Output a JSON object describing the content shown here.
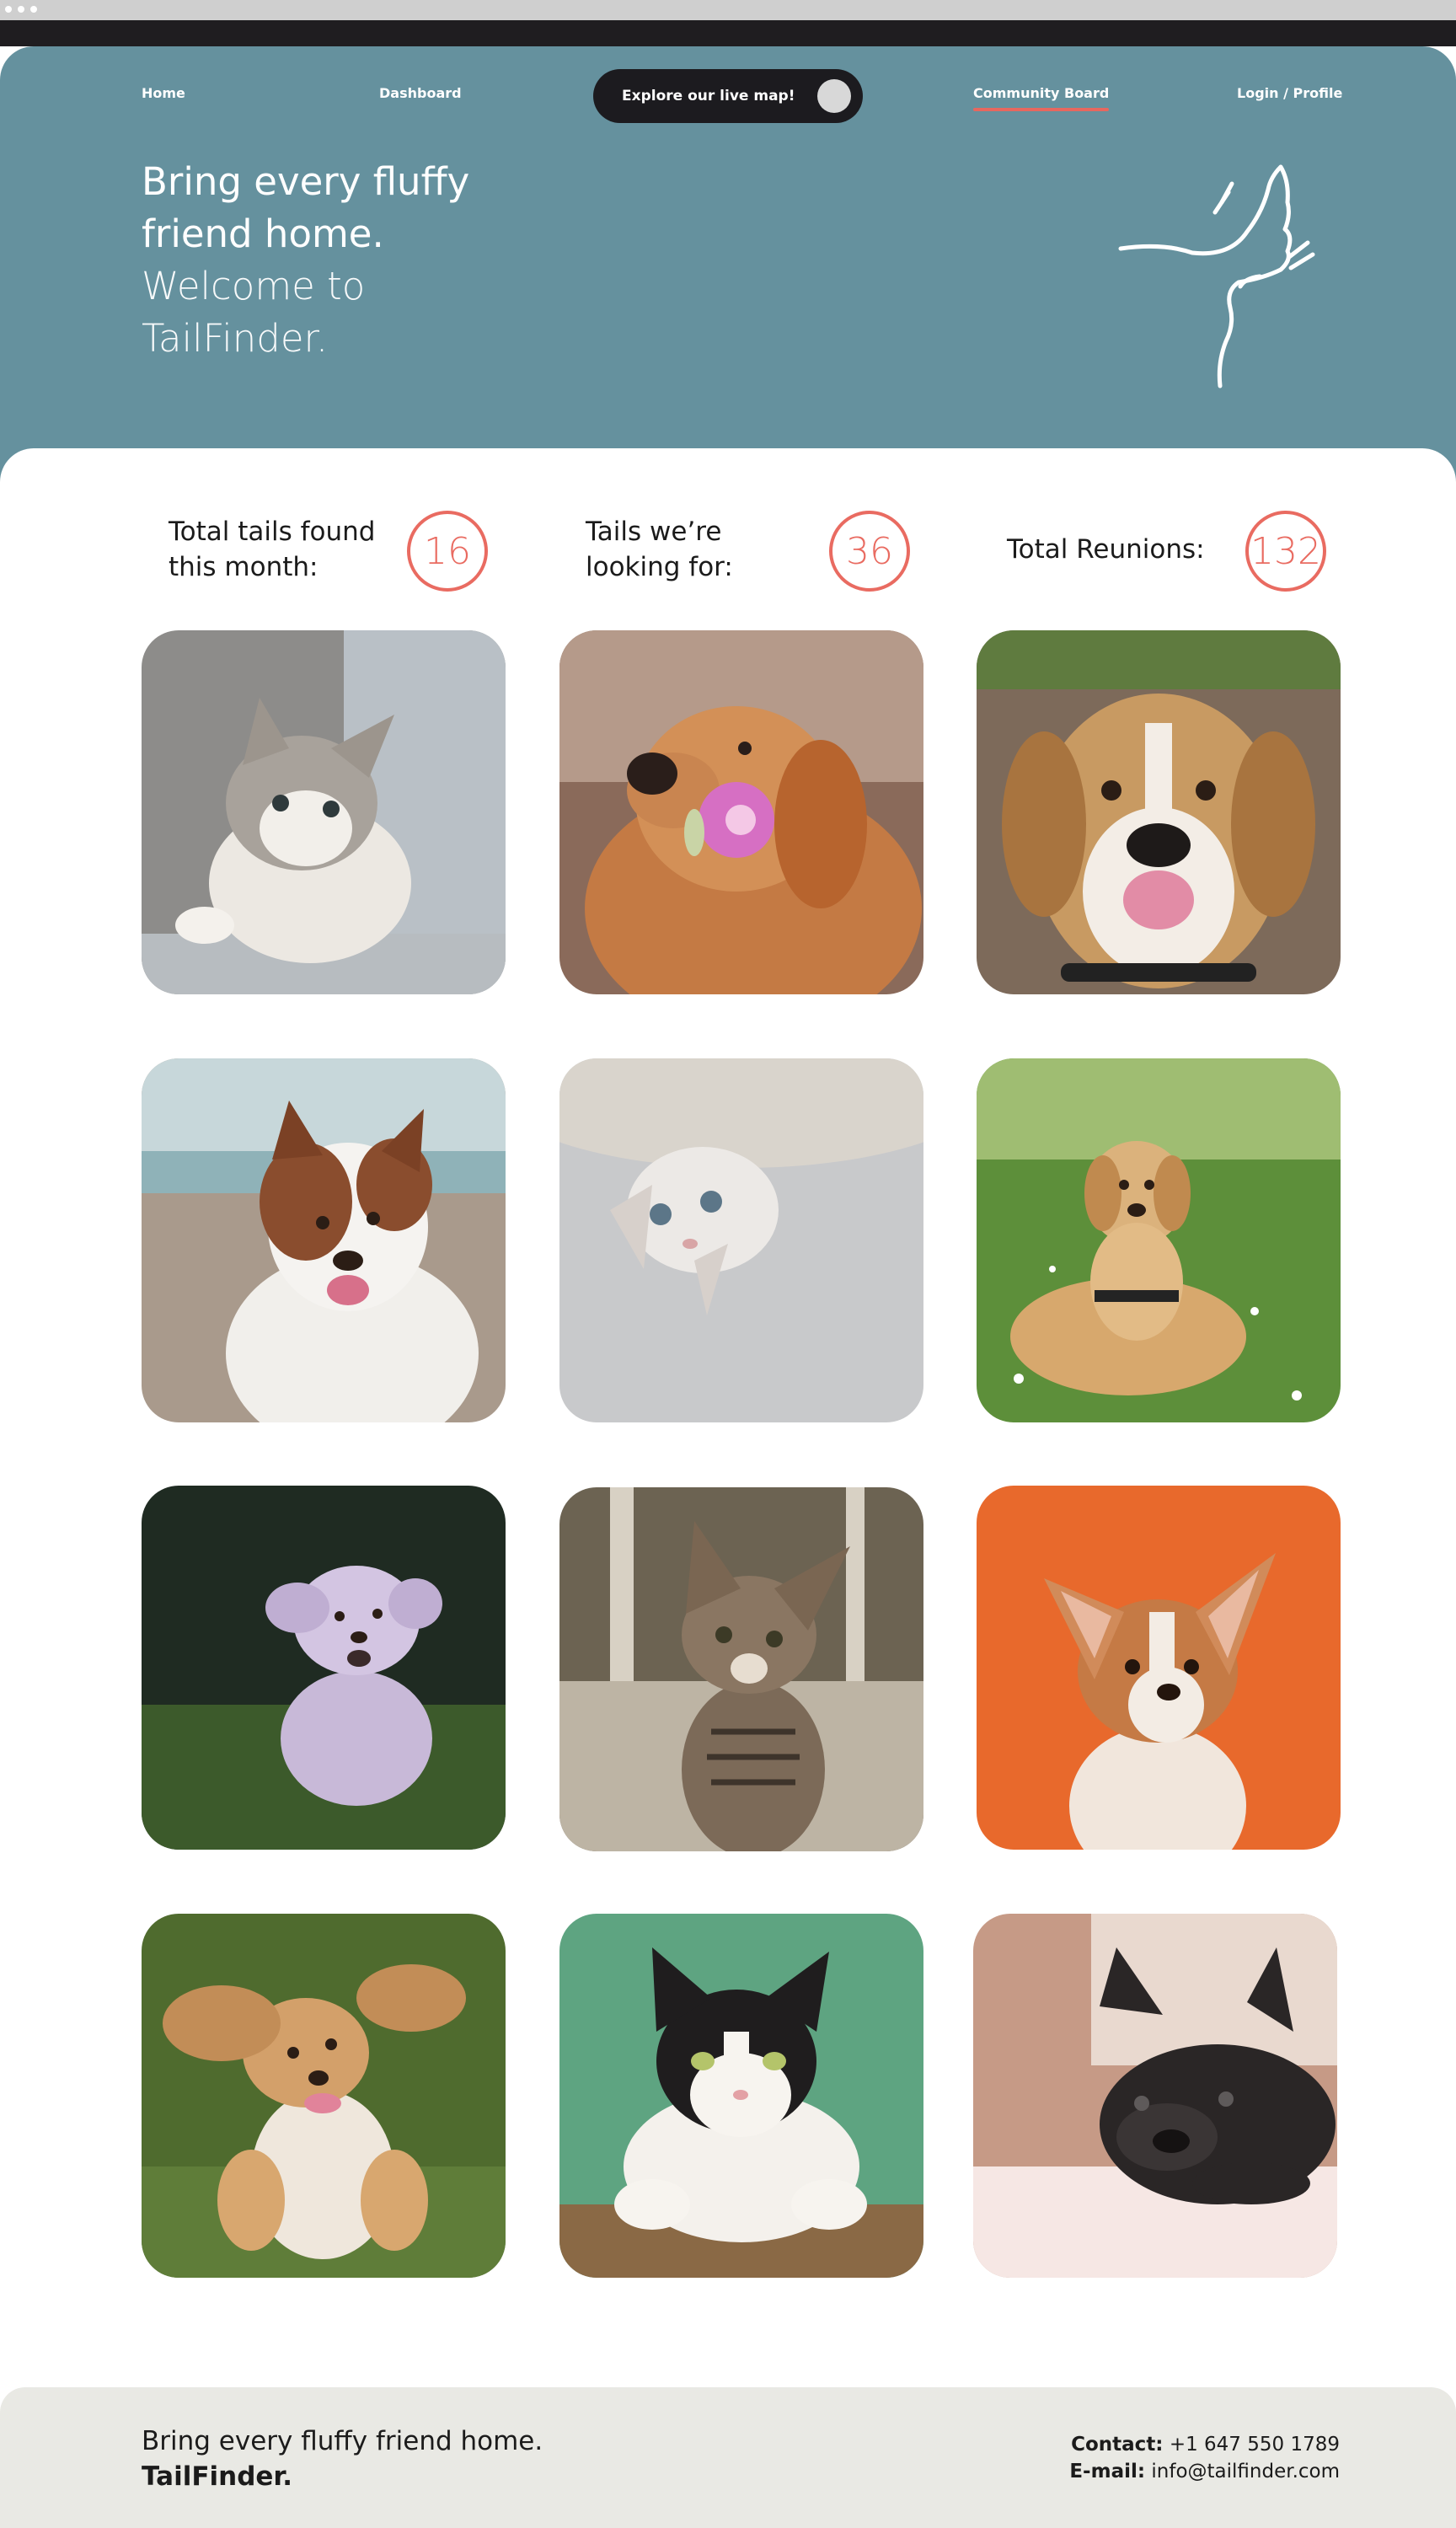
{
  "nav": {
    "home": "Home",
    "dashboard": "Dashboard",
    "map_toggle": "Explore our live map!",
    "community": "Community Board",
    "login": "Login / Profile"
  },
  "hero": {
    "line1": "Bring every fluffy friend home.",
    "line2": "Welcome to TailFinder."
  },
  "stats": [
    {
      "label": "Total tails found this month:",
      "value": "16"
    },
    {
      "label": "Tails we’re looking for:",
      "value": "36"
    },
    {
      "label": "Total Reunions:",
      "value": "132"
    }
  ],
  "pets": [
    "fluffy grey-white kitten",
    "golden retriever with pink flower",
    "smiling beagle",
    "australian shepherd",
    "upside-down white kitten",
    "golden retriever lying in grass",
    "running fluffy lavender puppy",
    "tabby kitten",
    "corgi puppy on orange background",
    "cocker spaniel lying in grass",
    "black-and-white cat on green background",
    "black french bulldog"
  ],
  "footer": {
    "tagline": "Bring every fluffy friend home.",
    "brand": "TailFinder.",
    "contact_label": "Contact:",
    "contact_value": "+1 647 550 1789",
    "email_label": "E-mail:",
    "email_value": "info@tailfinder.com"
  },
  "colors": {
    "header_bg": "#65919e",
    "accent": "#e96b61",
    "footer_bg": "#e9e9e4",
    "dark": "#1c1b1f"
  }
}
